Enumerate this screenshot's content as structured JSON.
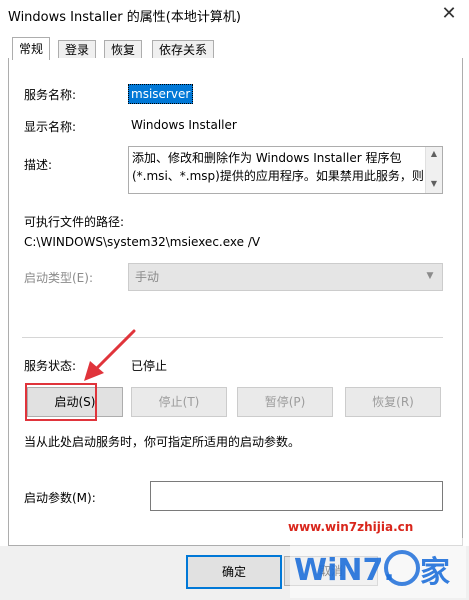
{
  "window": {
    "title": "Windows Installer 的属性(本地计算机)"
  },
  "tabs": [
    {
      "label": "常规",
      "active": true
    },
    {
      "label": "登录",
      "active": false
    },
    {
      "label": "恢复",
      "active": false
    },
    {
      "label": "依存关系",
      "active": false
    }
  ],
  "general": {
    "service_name_label": "服务名称:",
    "service_name_value": "msiserver",
    "display_name_label": "显示名称:",
    "display_name_value": "Windows Installer",
    "description_label": "描述:",
    "description_line1": "添加、修改和删除作为 Windows Installer 程序包",
    "description_line2": "(*.msi、*.msp)提供的应用程序。如果禁用此服务，则",
    "exe_path_label": "可执行文件的路径:",
    "exe_path_value": "C:\\WINDOWS\\system32\\msiexec.exe /V",
    "startup_type_label": "启动类型(E):",
    "startup_type_value": "手动",
    "status_label": "服务状态:",
    "status_value": "已停止",
    "buttons": {
      "start": "启动(S)",
      "stop": "停止(T)",
      "pause": "暂停(P)",
      "resume": "恢复(R)"
    },
    "hint": "当从此处启动服务时，你可指定所适用的启动参数。",
    "start_params_label": "启动参数(M):",
    "start_params_value": ""
  },
  "footer": {
    "ok": "确定",
    "cancel": "取消"
  },
  "watermark": {
    "url": "www.win7zhijia.cn",
    "logo_text": "WiN7.之家"
  },
  "colors": {
    "selection": "#0078d7",
    "annotation": "#e0343b",
    "watermark": "#d9261c",
    "logo_blue": "#1e6fd9"
  }
}
